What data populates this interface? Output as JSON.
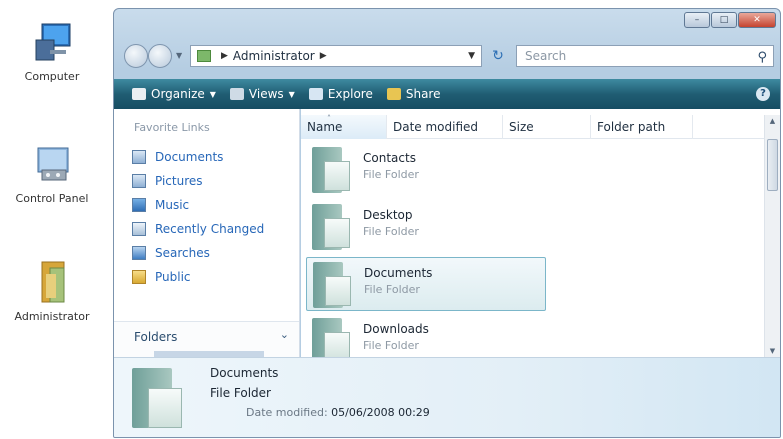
{
  "desktop": {
    "icons": [
      {
        "label": "Computer",
        "icon": "computer-icon"
      },
      {
        "label": "Control Panel",
        "icon": "control-panel-icon"
      },
      {
        "label": "Administrator",
        "icon": "user-folder-icon"
      }
    ]
  },
  "window": {
    "address": {
      "segment": "Administrator"
    },
    "search": {
      "placeholder": "Search"
    },
    "toolbar": {
      "organize": "Organize",
      "views": "Views",
      "explore": "Explore",
      "share": "Share"
    },
    "left_pane": {
      "favorites_title": "Favorite Links",
      "links": [
        "Documents",
        "Pictures",
        "Music",
        "Recently Changed",
        "Searches",
        "Public"
      ],
      "folders_label": "Folders"
    },
    "columns": [
      "Name",
      "Date modified",
      "Size",
      "Folder path"
    ],
    "files": [
      {
        "name": "Contacts",
        "type": "File Folder"
      },
      {
        "name": "Desktop",
        "type": "File Folder"
      },
      {
        "name": "Documents",
        "type": "File Folder"
      },
      {
        "name": "Downloads",
        "type": "File Folder"
      }
    ],
    "details": {
      "name": "Documents",
      "type": "File Folder",
      "modified_label": "Date modified:",
      "modified_value": "05/06/2008 00:29"
    }
  },
  "colors": {
    "toolbar": "#205d73",
    "link": "#2767b8",
    "selection_border": "#7bb6c9"
  }
}
